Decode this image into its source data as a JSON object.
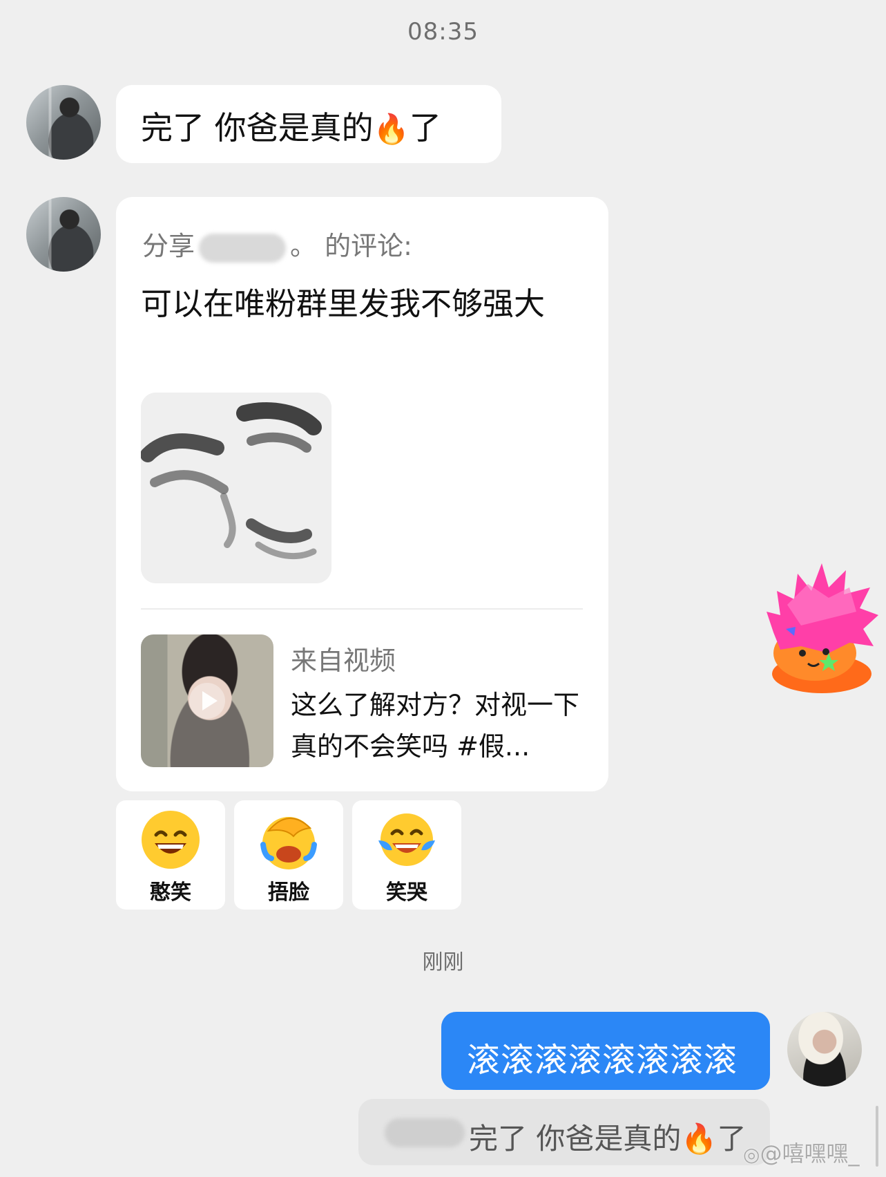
{
  "timestamps": {
    "top": "08:35",
    "middle": "刚刚"
  },
  "message1": {
    "text_before": "完了 你爸是真的",
    "emoji": "🔥",
    "text_after": "了"
  },
  "share_card": {
    "share_prefix": "分享",
    "share_suffix": "。 的评论:",
    "comment": "可以在唯粉群里发我不够强大",
    "video_source": "来自视频",
    "video_title": "这么了解对方？对视一下真的不会笑吗 #假..."
  },
  "reactions": [
    {
      "label": "憨笑",
      "icon": "grin-face-icon"
    },
    {
      "label": "捂脸",
      "icon": "facepalm-icon"
    },
    {
      "label": "笑哭",
      "icon": "tears-of-joy-icon"
    }
  ],
  "my_message": {
    "text": "滚滚滚滚滚滚滚滚"
  },
  "quoted_message": {
    "text_before": "完了 你爸是真的",
    "emoji": "🔥",
    "text_after": "了"
  },
  "watermark": {
    "text": "@嘻嘿嘿_"
  },
  "colors": {
    "accent": "#2b87f6",
    "background": "#efefef",
    "bubble": "#ffffff"
  }
}
